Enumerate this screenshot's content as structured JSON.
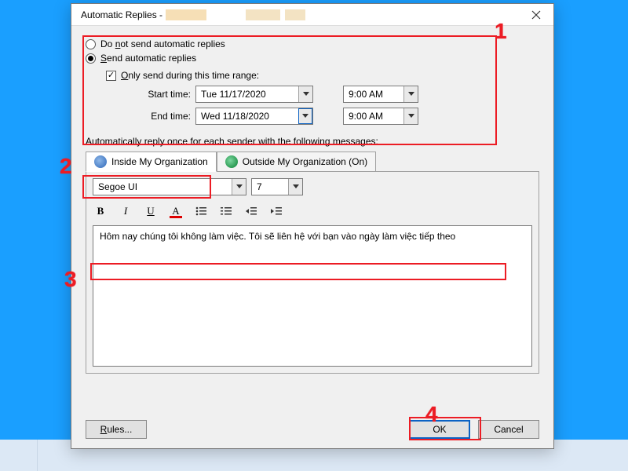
{
  "window": {
    "title": "Automatic Replies - "
  },
  "options": {
    "do_not_send_pre": "Do ",
    "do_not_send_key": "n",
    "do_not_send_post": "ot send automatic replies",
    "send_key": "S",
    "send_post": "end automatic replies",
    "only_send_pre": "",
    "only_send_key": "O",
    "only_send_post": "nly send during this time range:"
  },
  "time": {
    "start_label": "Start time:",
    "end_label": "End time:",
    "start_date": "Tue 11/17/2020",
    "end_date": "Wed 11/18/2020",
    "start_time": "9:00 AM",
    "end_time": "9:00 AM"
  },
  "section_label": "Automatically reply once for each sender with the following messages:",
  "tabs": {
    "inside": "Inside My Organization",
    "outside": "Outside My Organization (On)"
  },
  "format": {
    "font": "Segoe UI",
    "size": "7"
  },
  "toolbar": {
    "bold": "B",
    "italic": "I",
    "underline": "U",
    "color": "A"
  },
  "editor": {
    "text": "Hôm nay chúng tôi không làm việc. Tôi sẽ liên hệ với bạn vào ngày làm việc tiếp theo"
  },
  "buttons": {
    "rules_key": "R",
    "rules_post": "ules...",
    "ok": "OK",
    "cancel": "Cancel"
  },
  "callouts": {
    "c1": "1",
    "c2": "2",
    "c3": "3",
    "c4": "4"
  }
}
